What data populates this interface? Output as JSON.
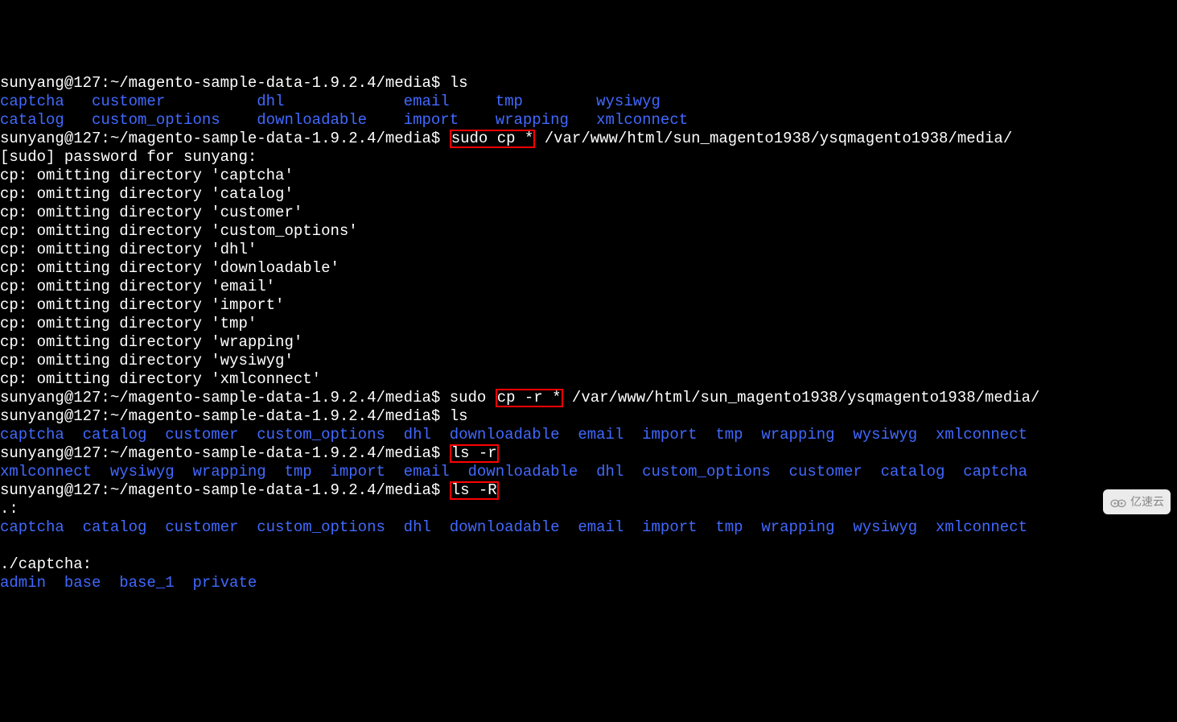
{
  "prompt_prefix": "sunyang@127:~/magento-sample-data-1.9.2.4/media$",
  "lines": [
    {
      "t": "prompt",
      "cmd": "ls"
    },
    {
      "t": "dirs_cols",
      "rows": [
        [
          "captcha",
          "customer",
          "dhl",
          "email",
          "tmp",
          "wysiwyg"
        ],
        [
          "catalog",
          "custom_options",
          "downloadable",
          "import",
          "wrapping",
          "xmlconnect"
        ]
      ],
      "widths": [
        10,
        18,
        16,
        10,
        11,
        0
      ]
    },
    {
      "t": "prompt_hl",
      "before": "sudo ",
      "hl": "sudo cp *",
      "after": " /var/www/html/sun_magento1938/ysqmagento1938/media/"
    },
    {
      "t": "plain",
      "text": "[sudo] password for sunyang:"
    },
    {
      "t": "plain",
      "text": "cp: omitting directory 'captcha'"
    },
    {
      "t": "plain",
      "text": "cp: omitting directory 'catalog'"
    },
    {
      "t": "plain",
      "text": "cp: omitting directory 'customer'"
    },
    {
      "t": "plain",
      "text": "cp: omitting directory 'custom_options'"
    },
    {
      "t": "plain",
      "text": "cp: omitting directory 'dhl'"
    },
    {
      "t": "plain",
      "text": "cp: omitting directory 'downloadable'"
    },
    {
      "t": "plain",
      "text": "cp: omitting directory 'email'"
    },
    {
      "t": "plain",
      "text": "cp: omitting directory 'import'"
    },
    {
      "t": "plain",
      "text": "cp: omitting directory 'tmp'"
    },
    {
      "t": "plain",
      "text": "cp: omitting directory 'wrapping'"
    },
    {
      "t": "plain",
      "text": "cp: omitting directory 'wysiwyg'"
    },
    {
      "t": "plain",
      "text": "cp: omitting directory 'xmlconnect'"
    },
    {
      "t": "prompt_hl2",
      "before": "sudo ",
      "hl": "cp -r *",
      "after": " /var/www/html/sun_magento1938/ysqmagento1938/media/"
    },
    {
      "t": "prompt",
      "cmd": "ls"
    },
    {
      "t": "dirs_row",
      "items": [
        "captcha",
        "catalog",
        "customer",
        "custom_options",
        "dhl",
        "downloadable",
        "email",
        "import",
        "tmp",
        "wrapping",
        "wysiwyg",
        "xmlconnect"
      ]
    },
    {
      "t": "prompt_hl3",
      "hl": "ls -r"
    },
    {
      "t": "dirs_row",
      "items": [
        "xmlconnect",
        "wysiwyg",
        "wrapping",
        "tmp",
        "import",
        "email",
        "downloadable",
        "dhl",
        "custom_options",
        "customer",
        "catalog",
        "captcha"
      ]
    },
    {
      "t": "prompt_hl3",
      "hl": "ls -R"
    },
    {
      "t": "plain",
      "text": ".:"
    },
    {
      "t": "dirs_row",
      "items": [
        "captcha",
        "catalog",
        "customer",
        "custom_options",
        "dhl",
        "downloadable",
        "email",
        "import",
        "tmp",
        "wrapping",
        "wysiwyg",
        "xmlconnect"
      ]
    },
    {
      "t": "blank"
    },
    {
      "t": "plain",
      "text": "./captcha:"
    },
    {
      "t": "dirs_row",
      "items": [
        "admin",
        "base",
        "base_1",
        "private"
      ]
    }
  ],
  "watermark_text": "亿速云"
}
